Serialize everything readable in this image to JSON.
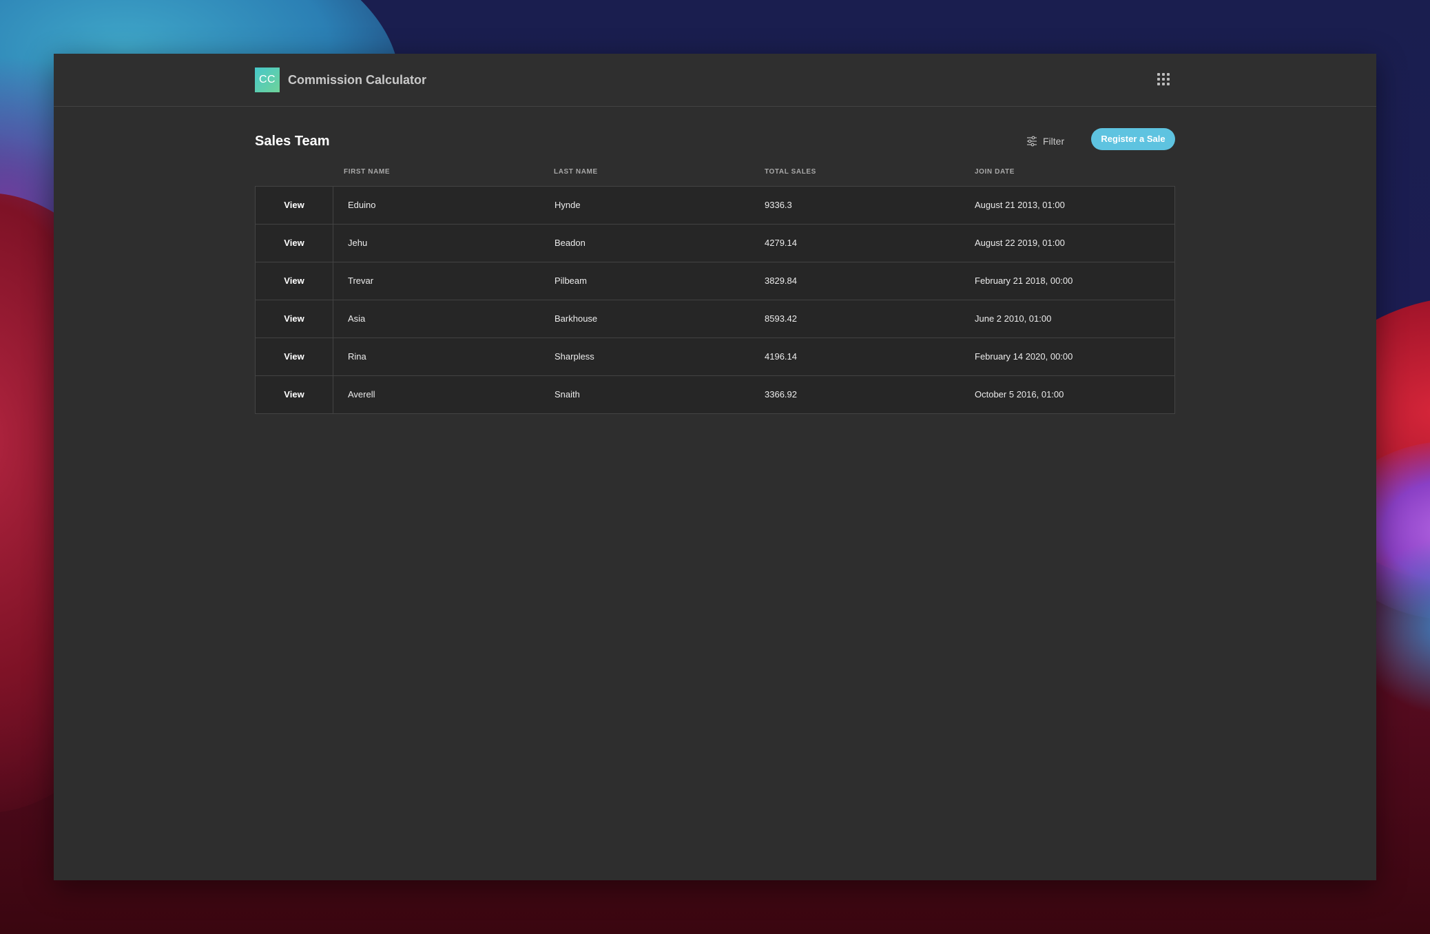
{
  "app": {
    "logo_text": "CC",
    "title": "Commission Calculator",
    "apps_icon": "grid-apps-icon"
  },
  "toolbar": {
    "page_title": "Sales Team",
    "filter_label": "Filter",
    "filter_icon": "sliders-icon",
    "register_label": "Register a Sale"
  },
  "colors": {
    "accent": "#5ec3e0",
    "window_bg": "#2e2e2e",
    "row_bg": "#262626"
  },
  "table": {
    "columns": [
      "FIRST NAME",
      "LAST NAME",
      "TOTAL SALES",
      "JOIN DATE"
    ],
    "view_label": "View",
    "rows": [
      {
        "first_name": "Eduino",
        "last_name": "Hynde",
        "total_sales": "9336.3",
        "join_date": "August 21 2013, 01:00"
      },
      {
        "first_name": "Jehu",
        "last_name": "Beadon",
        "total_sales": "4279.14",
        "join_date": "August 22 2019, 01:00"
      },
      {
        "first_name": "Trevar",
        "last_name": "Pilbeam",
        "total_sales": "3829.84",
        "join_date": "February 21 2018, 00:00"
      },
      {
        "first_name": "Asia",
        "last_name": "Barkhouse",
        "total_sales": "8593.42",
        "join_date": "June 2 2010, 01:00"
      },
      {
        "first_name": "Rina",
        "last_name": "Sharpless",
        "total_sales": "4196.14",
        "join_date": "February 14 2020, 00:00"
      },
      {
        "first_name": "Averell",
        "last_name": "Snaith",
        "total_sales": "3366.92",
        "join_date": "October 5 2016, 01:00"
      }
    ]
  }
}
